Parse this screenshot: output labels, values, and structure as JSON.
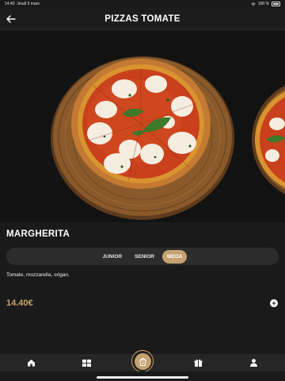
{
  "status_bar": {
    "time": "14:40",
    "date": "Jeudi 5 mars",
    "battery": "100 %",
    "icons": [
      "wifi-icon",
      "battery-icon"
    ]
  },
  "header": {
    "title": "PIZZAS TOMATE",
    "back_icon": "back-arrow-icon"
  },
  "product": {
    "name": "MARGHERITA",
    "sizes": [
      {
        "label": "JUNIOR",
        "selected": false
      },
      {
        "label": "SENIOR",
        "selected": false
      },
      {
        "label": "MEGA",
        "selected": true
      }
    ],
    "description": "Tomate, mozzarella, origan.",
    "price": "14.40€",
    "add_icon": "plus-icon"
  },
  "tab_bar": {
    "items": [
      "home-icon",
      "menu-grid-icon",
      "bag-icon",
      "gift-icon",
      "profile-icon"
    ],
    "active": "bag-icon"
  },
  "colors": {
    "accent": "#c5a271",
    "price": "#c9a46c",
    "background": "#1a1a1a",
    "hero_background": "#121212"
  }
}
